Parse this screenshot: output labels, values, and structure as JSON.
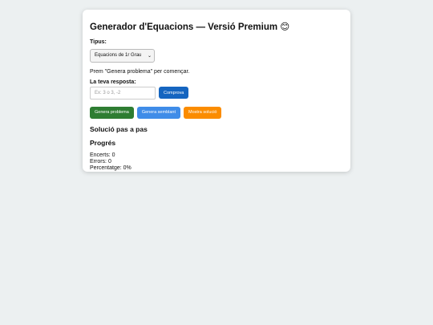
{
  "title": "Generador d'Equacions — Versió Premium 😊",
  "type_label": "Tipus:",
  "type_select": "Equacions de 1r Grau",
  "message": "Prem \"Genera problema\" per començar.",
  "answer_label": "La teva resposta:",
  "answer_placeholder": "Ex: 3 o 3, -2",
  "check_button": "Comprova",
  "buttons": {
    "generate": "Genera problema",
    "similar": "Genera semblant",
    "solution": "Mostra solució"
  },
  "solution_heading": "Solució pas a pas",
  "progress_heading": "Progrés",
  "stats": {
    "correct": "Encerts: 0",
    "errors": "Errors: 0",
    "percentage": "Percentatge: 0%"
  },
  "colors": {
    "background": "#ecf0f1",
    "check": "#1565c0",
    "generate": "#2e7d32",
    "similar": "#3f8ce8",
    "solution": "#fb8c00"
  }
}
